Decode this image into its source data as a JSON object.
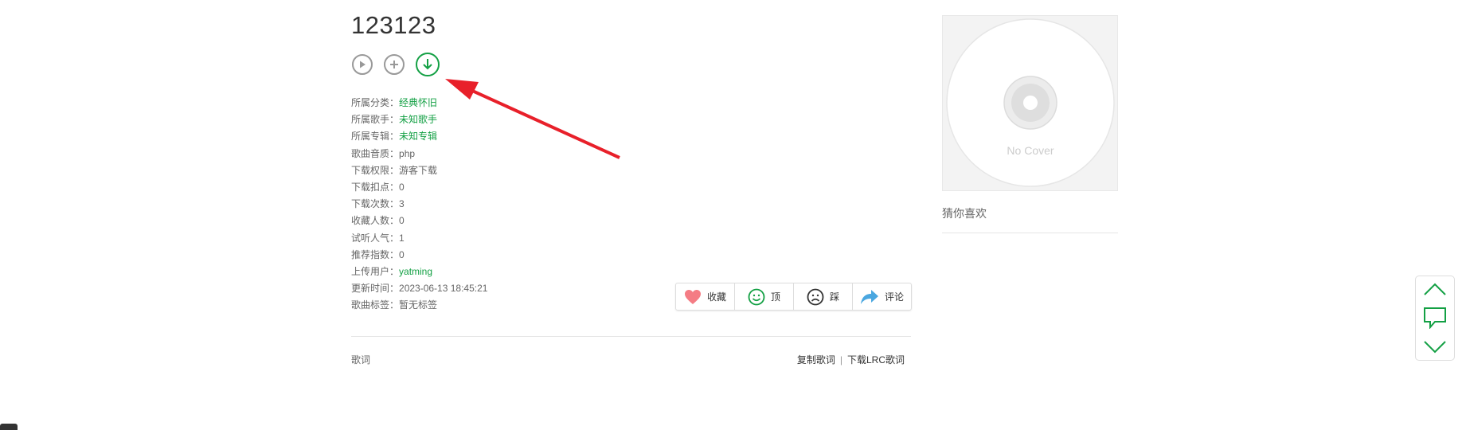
{
  "song": {
    "title": "123123"
  },
  "controls": {
    "play_icon": "play-icon",
    "add_icon": "plus-icon",
    "download_icon": "download-icon"
  },
  "info": [
    {
      "label": "所属分类：",
      "value": "经典怀旧",
      "link": true
    },
    {
      "label": "所属歌手：",
      "value": "未知歌手",
      "link": true
    },
    {
      "label": "所属专辑：",
      "value": "未知专辑",
      "link": true
    },
    {
      "label": "歌曲音质：",
      "value": "php",
      "link": false
    },
    {
      "label": "下载权限：",
      "value": "游客下载",
      "link": false
    },
    {
      "label": "下载扣点：",
      "value": "0",
      "link": false
    },
    {
      "label": "下载次数：",
      "value": "3",
      "link": false
    },
    {
      "label": "收藏人数：",
      "value": "0",
      "link": false
    },
    {
      "label": "试听人气：",
      "value": "1",
      "link": false
    },
    {
      "label": "推荐指数：",
      "value": "0",
      "link": false
    },
    {
      "label": "上传用户：",
      "value": "yatming",
      "link": true
    },
    {
      "label": "更新时间：",
      "value": "2023-06-13 18:45:21",
      "link": false
    },
    {
      "label": "歌曲标签：",
      "value": "暂无标签",
      "link": false
    }
  ],
  "actions": {
    "favorite": "收藏",
    "up": "顶",
    "down": "踩",
    "comment": "评论"
  },
  "lyrics": {
    "label": "歌词",
    "copy": "复制歌词",
    "separator": "|",
    "download_lrc": "下载LRC歌词"
  },
  "sidebar": {
    "cover_text": "No Cover",
    "guess_title": "猜你喜欢"
  },
  "colors": {
    "green": "#13a044",
    "arrow_red": "#e8202a",
    "heart": "#f47c84",
    "share": "#4aa7e0"
  }
}
